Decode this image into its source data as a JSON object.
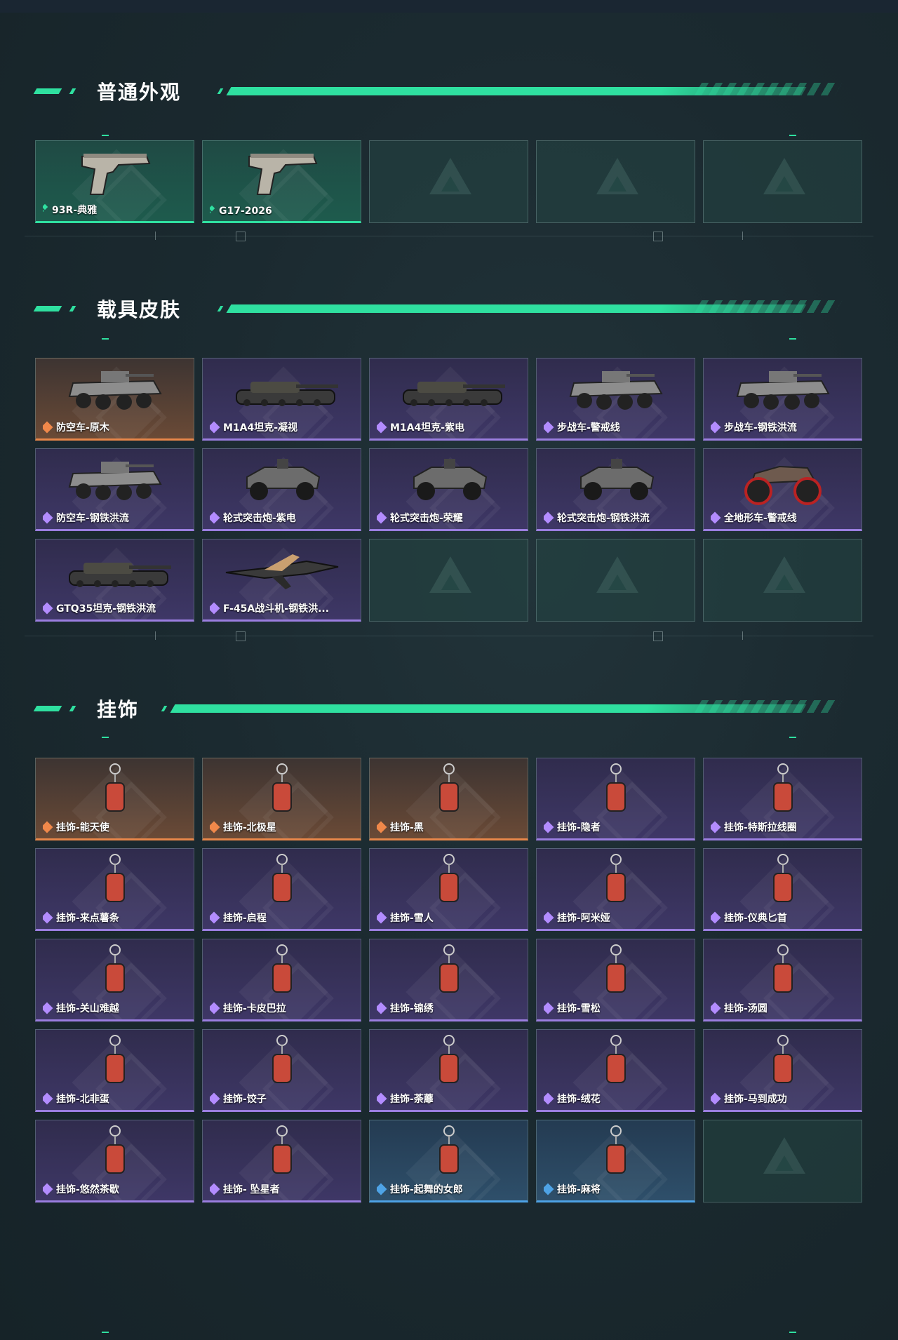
{
  "sections": [
    {
      "title": "普通外观",
      "items": [
        {
          "label": "93R-典雅",
          "rarity": "green",
          "icon": "pistol-icon"
        },
        {
          "label": "G17-2026",
          "rarity": "green",
          "icon": "pistol-icon"
        },
        {
          "label": "",
          "rarity": "empty"
        },
        {
          "label": "",
          "rarity": "empty"
        },
        {
          "label": "",
          "rarity": "empty"
        }
      ]
    },
    {
      "title": "载具皮肤",
      "items": [
        {
          "label": "防空车-原木",
          "rarity": "orange",
          "icon": "armored-vehicle-icon"
        },
        {
          "label": "M1A4坦克-凝视",
          "rarity": "purple",
          "icon": "tank-icon"
        },
        {
          "label": "M1A4坦克-紫电",
          "rarity": "purple",
          "icon": "tank-icon"
        },
        {
          "label": "步战车-警戒线",
          "rarity": "purple",
          "icon": "armored-vehicle-icon"
        },
        {
          "label": "步战车-钢铁洪流",
          "rarity": "purple",
          "icon": "armored-vehicle-icon"
        },
        {
          "label": "防空车-钢铁洪流",
          "rarity": "purple",
          "icon": "armored-vehicle-icon"
        },
        {
          "label": "轮式突击炮-紫电",
          "rarity": "purple",
          "icon": "buggy-icon"
        },
        {
          "label": "轮式突击炮-荣耀",
          "rarity": "purple",
          "icon": "buggy-icon"
        },
        {
          "label": "轮式突击炮-钢铁洪流",
          "rarity": "purple",
          "icon": "buggy-icon"
        },
        {
          "label": "全地形车-警戒线",
          "rarity": "purple",
          "icon": "atv-icon"
        },
        {
          "label": "GTQ35坦克-钢铁洪流",
          "rarity": "purple",
          "icon": "tank-icon"
        },
        {
          "label": "F-45A战斗机-钢铁洪...",
          "rarity": "purple",
          "icon": "jet-icon"
        },
        {
          "label": "",
          "rarity": "empty"
        },
        {
          "label": "",
          "rarity": "empty"
        },
        {
          "label": "",
          "rarity": "empty"
        }
      ]
    },
    {
      "title": "挂饰",
      "items": [
        {
          "label": "挂饰-能天使",
          "rarity": "orange",
          "icon": "charm-icon"
        },
        {
          "label": "挂饰-北极星",
          "rarity": "orange",
          "icon": "charm-icon"
        },
        {
          "label": "挂饰-黑",
          "rarity": "orange",
          "icon": "charm-icon"
        },
        {
          "label": "挂饰-隐者",
          "rarity": "purple",
          "icon": "charm-icon"
        },
        {
          "label": "挂饰-特斯拉线圈",
          "rarity": "purple",
          "icon": "charm-icon"
        },
        {
          "label": "挂饰-来点薯条",
          "rarity": "purple",
          "icon": "charm-icon"
        },
        {
          "label": "挂饰-启程",
          "rarity": "purple",
          "icon": "charm-icon"
        },
        {
          "label": "挂饰-雪人",
          "rarity": "purple",
          "icon": "charm-icon"
        },
        {
          "label": "挂饰-阿米娅",
          "rarity": "purple",
          "icon": "charm-icon"
        },
        {
          "label": "挂饰-仪典匕首",
          "rarity": "purple",
          "icon": "charm-icon"
        },
        {
          "label": "挂饰-关山难越",
          "rarity": "purple",
          "icon": "charm-icon"
        },
        {
          "label": "挂饰-卡皮巴拉",
          "rarity": "purple",
          "icon": "charm-icon"
        },
        {
          "label": "挂饰-锦绣",
          "rarity": "purple",
          "icon": "charm-icon"
        },
        {
          "label": "挂饰-雪松",
          "rarity": "purple",
          "icon": "charm-icon"
        },
        {
          "label": "挂饰-汤圆",
          "rarity": "purple",
          "icon": "charm-icon"
        },
        {
          "label": "挂饰-北非蛋",
          "rarity": "purple",
          "icon": "charm-icon"
        },
        {
          "label": "挂饰-饺子",
          "rarity": "purple",
          "icon": "charm-icon"
        },
        {
          "label": "挂饰-荼蘼",
          "rarity": "purple",
          "icon": "charm-icon"
        },
        {
          "label": "挂饰-绒花",
          "rarity": "purple",
          "icon": "charm-icon"
        },
        {
          "label": "挂饰-马到成功",
          "rarity": "purple",
          "icon": "charm-icon"
        },
        {
          "label": "挂饰-悠然茶歇",
          "rarity": "purple",
          "icon": "charm-icon"
        },
        {
          "label": "挂饰- 坠星者",
          "rarity": "purple",
          "icon": "charm-icon"
        },
        {
          "label": "挂饰-起舞的女郎",
          "rarity": "blue",
          "icon": "charm-icon"
        },
        {
          "label": "挂饰-麻将",
          "rarity": "blue",
          "icon": "charm-icon"
        },
        {
          "label": "",
          "rarity": "empty"
        }
      ]
    }
  ],
  "colors": {
    "accent": "#2fe0a0",
    "purple": "#9b7ee0",
    "orange": "#e8874a",
    "blue": "#4ea3e6"
  }
}
